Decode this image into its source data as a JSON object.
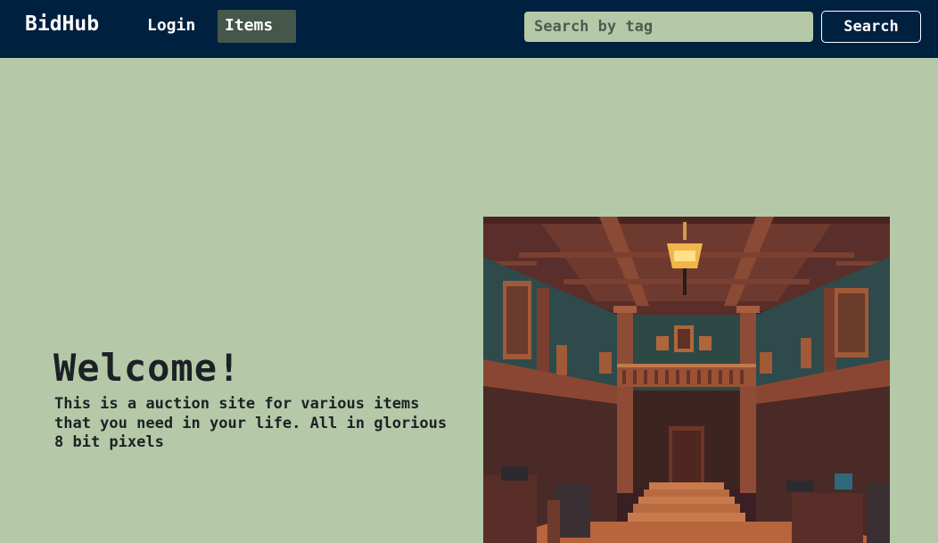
{
  "navbar": {
    "brand": "BidHub",
    "links": [
      {
        "label": "Login",
        "active": false
      },
      {
        "label": "Items",
        "active": true
      }
    ],
    "search": {
      "placeholder": "Search by tag",
      "value": "",
      "button_label": "Search"
    }
  },
  "hero": {
    "title": "Welcome!",
    "text": "This is a auction site for various items that you need in your life. All in glorious 8 bit pixels",
    "image": "auction-hall-pixel-art"
  },
  "colors": {
    "navbar_bg": "#00203f",
    "page_bg": "#b5c9a8",
    "active_link_bg": "#44574a",
    "text_dark": "#1c2126"
  }
}
